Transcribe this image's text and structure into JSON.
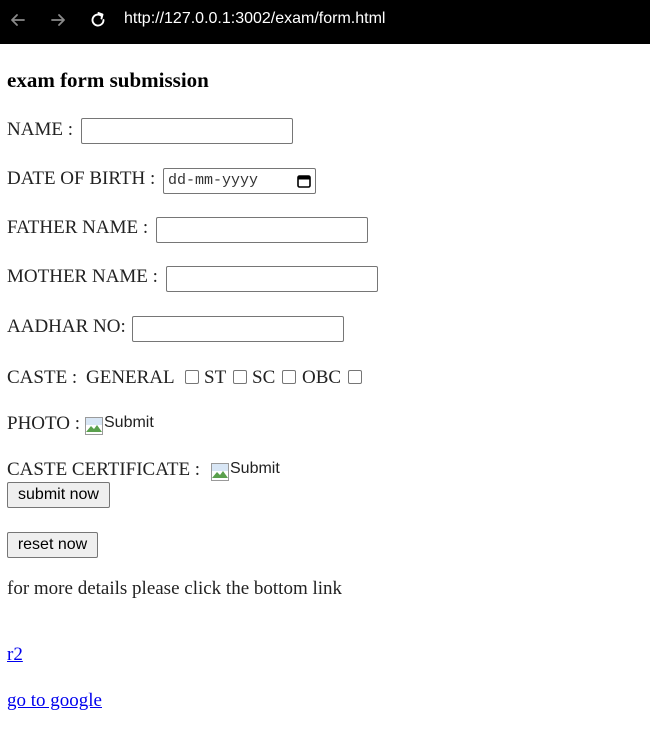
{
  "browser": {
    "url": "http://127.0.0.1:3002/exam/form.html",
    "back_icon": "arrow-left-icon",
    "forward_icon": "arrow-right-icon",
    "reload_icon": "reload-icon"
  },
  "form": {
    "title": "exam form submission",
    "name_label": "NAME :",
    "name_value": "",
    "dob_label": "DATE OF BIRTH :",
    "dob_placeholder": "dd-mm-yyyy",
    "father_label": "FATHER NAME :",
    "father_value": "",
    "mother_label": "MOTHER NAME :",
    "mother_value": "",
    "aadhar_label": "AADHAR NO:",
    "aadhar_value": "",
    "caste_label": "CASTE :",
    "caste_options": [
      "GENERAL",
      "ST",
      "SC",
      "OBC"
    ],
    "photo_label": "PHOTO :",
    "photo_alt": "Submit",
    "caste_cert_label": "CASTE CERTIFICATE :",
    "caste_cert_alt": "Submit",
    "submit_label": "submit now",
    "reset_label": "reset now",
    "details_text": "for more details please click the bottom link",
    "link_r2": "r2",
    "link_google": "go to google"
  },
  "colors": {
    "browser_bar": "#000000",
    "link": "#0000ee",
    "button_bg": "#efefef"
  }
}
